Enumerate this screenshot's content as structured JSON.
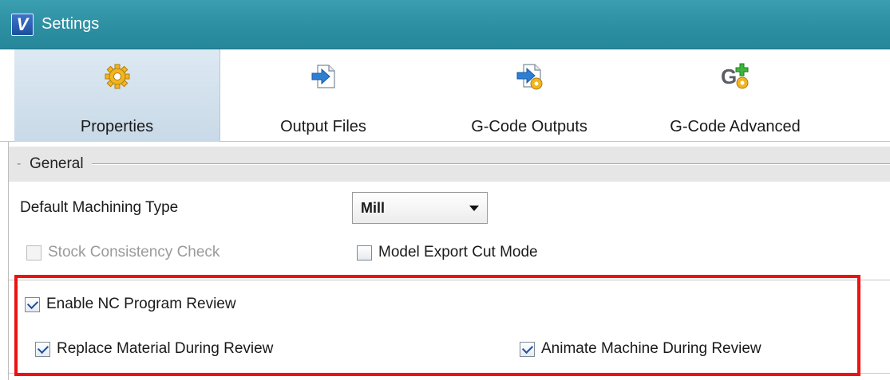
{
  "window": {
    "title": "Settings",
    "logo_letter": "V"
  },
  "tabs": [
    {
      "label": "Properties",
      "icon": "gear-icon",
      "active": true
    },
    {
      "label": "Output Files",
      "icon": "file-arrow-icon",
      "active": false
    },
    {
      "label": "G-Code Outputs",
      "icon": "file-arrow-gear-icon",
      "active": false
    },
    {
      "label": "G-Code Advanced",
      "icon": "g-plus-gear-icon",
      "active": false
    }
  ],
  "group": {
    "title": "General",
    "toggle": "-"
  },
  "machining_type": {
    "label": "Default Machining Type",
    "value": "Mill"
  },
  "stock_check": {
    "label": "Stock Consistency Check",
    "checked": false,
    "disabled": true
  },
  "model_export": {
    "label": "Model Export Cut Mode",
    "checked": false
  },
  "nc_review": {
    "label": "Enable NC Program Review",
    "checked": true
  },
  "replace_material": {
    "label": "Replace Material During Review",
    "checked": true
  },
  "animate_machine": {
    "label": "Animate Machine During Review",
    "checked": true
  },
  "colors": {
    "titlebar": "#2d8fa2",
    "active_tab": "#c8d9e7",
    "highlight": "#ee1111",
    "check": "#1f4fa3"
  }
}
